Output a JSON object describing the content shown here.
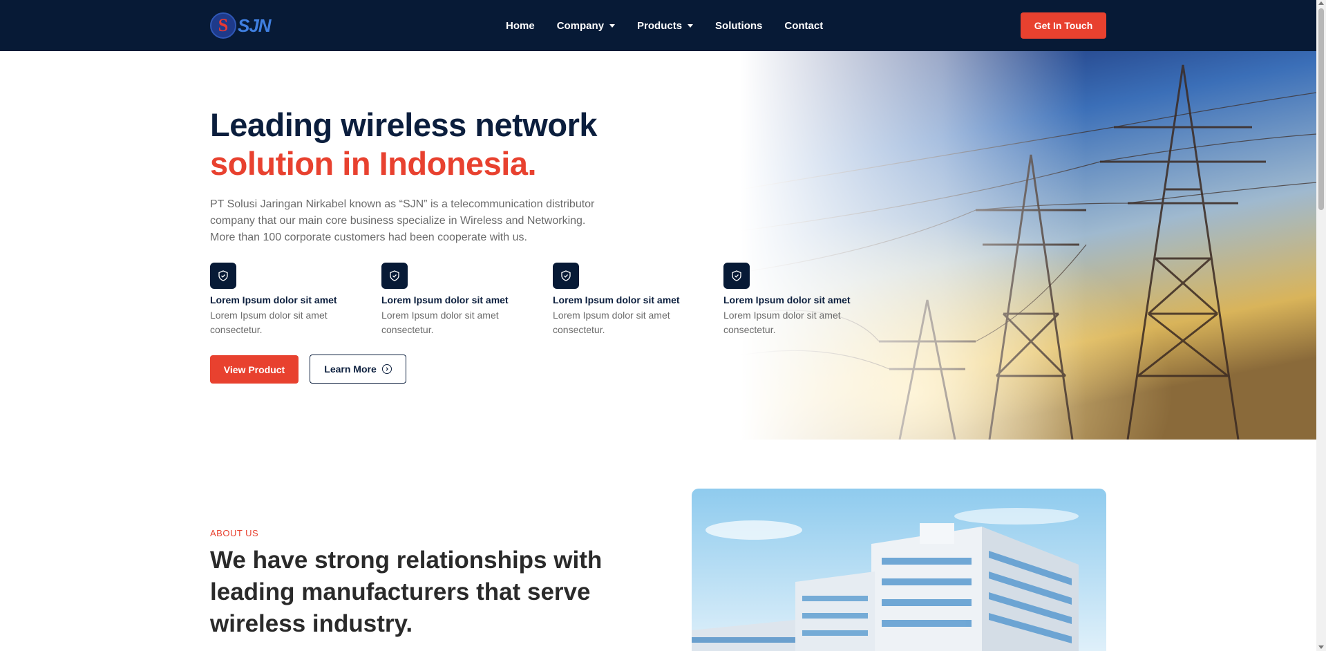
{
  "nav": {
    "logo_text": "SJN",
    "items": [
      {
        "label": "Home",
        "dropdown": false
      },
      {
        "label": "Company",
        "dropdown": true
      },
      {
        "label": "Products",
        "dropdown": true
      },
      {
        "label": "Solutions",
        "dropdown": false
      },
      {
        "label": "Contact",
        "dropdown": false
      }
    ],
    "cta_label": "Get In Touch"
  },
  "hero": {
    "title_line1": "Leading wireless network",
    "title_line2": "solution in Indonesia.",
    "description": "PT Solusi Jaringan Nirkabel known as “SJN” is a telecommunication distributor company that our main core business specialize in Wireless and Networking. More than 100 corporate customers had been cooperate with us.",
    "features": [
      {
        "icon": "shield-check-icon",
        "title": "Lorem Ipsum dolor sit amet",
        "desc": "Lorem Ipsum dolor sit amet consectetur."
      },
      {
        "icon": "shield-check-icon",
        "title": "Lorem Ipsum dolor sit amet",
        "desc": "Lorem Ipsum dolor sit amet consectetur."
      },
      {
        "icon": "shield-check-icon",
        "title": "Lorem Ipsum dolor sit amet",
        "desc": "Lorem Ipsum dolor sit amet consectetur."
      },
      {
        "icon": "shield-check-icon",
        "title": "Lorem Ipsum dolor sit amet",
        "desc": "Lorem Ipsum dolor sit amet consectetur."
      }
    ],
    "primary_button": "View Product",
    "secondary_button": "Learn More",
    "image_alt": "electricity transmission towers at sunset"
  },
  "about": {
    "label": "ABOUT US",
    "title": "We have strong relationships with leading manufacturers that serve wireless industry.",
    "image_alt": "modern office building"
  },
  "colors": {
    "navy": "#071a36",
    "accent": "#e8412f",
    "text_muted": "#6b6b6b"
  }
}
